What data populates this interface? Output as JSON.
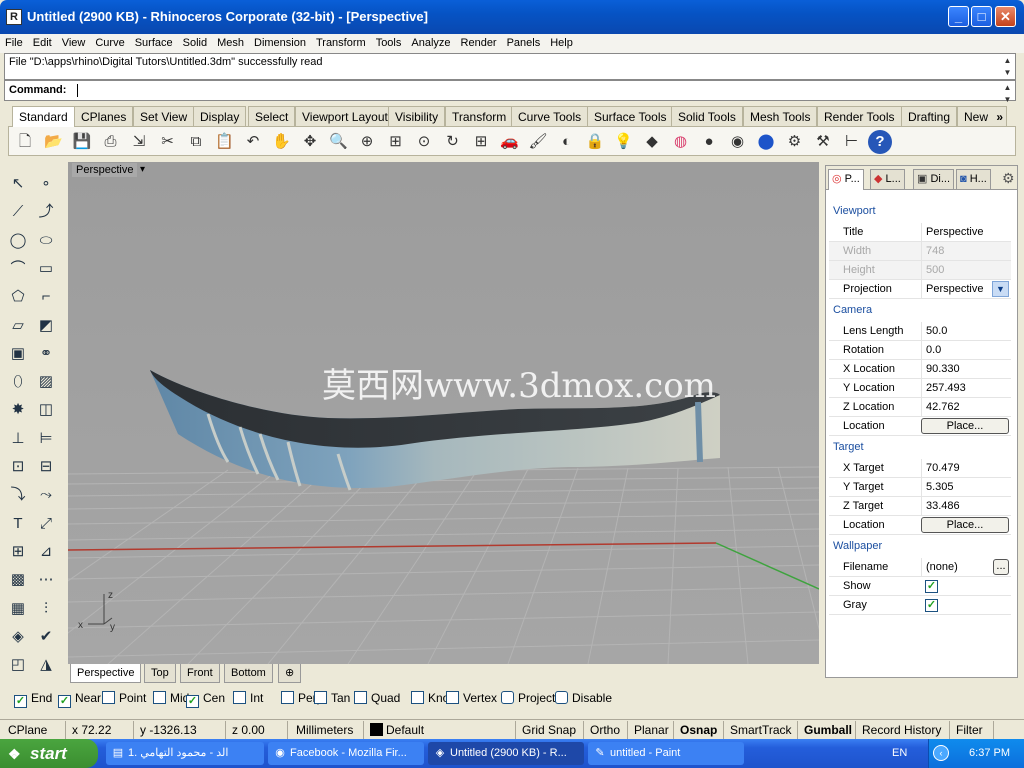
{
  "window": {
    "title": "Untitled (2900 KB) - Rhinoceros Corporate (32-bit) - [Perspective]",
    "minimize_glyph": "_",
    "maximize_glyph": "□",
    "close_glyph": "✕"
  },
  "menu": [
    "File",
    "Edit",
    "View",
    "Curve",
    "Surface",
    "Solid",
    "Mesh",
    "Dimension",
    "Transform",
    "Tools",
    "Analyze",
    "Render",
    "Panels",
    "Help"
  ],
  "command": {
    "history": "File \"D:\\apps\\rhino\\Digital Tutors\\Untitled.3dm\" successfully read",
    "label": "Command:"
  },
  "toolbar_tabs": [
    "Standard",
    "CPlanes",
    "Set View",
    "Display",
    "Select",
    "Viewport Layout",
    "Visibility",
    "Transform",
    "Curve Tools",
    "Surface Tools",
    "Solid Tools",
    "Mesh Tools",
    "Render Tools",
    "Drafting",
    "New"
  ],
  "toolbar_more": "»",
  "toolbar_icons": [
    "new-file-icon",
    "open-icon",
    "save-icon",
    "print-icon",
    "import-icon",
    "cut-icon",
    "copy-icon",
    "paste-icon",
    "undo-icon",
    "pan-icon",
    "rotate-view-icon",
    "zoom-icon",
    "zoom-window-icon",
    "zoom-extents-icon",
    "zoom-selected-icon",
    "rotate-icon",
    "four-viewports-icon",
    "car-icon",
    "paint-icon",
    "hide-icon",
    "lock-icon",
    "lightbulb-icon",
    "layer-icon",
    "color-wheel-icon",
    "sphere-shaded-icon",
    "sphere-render-icon",
    "sphere-blue-icon",
    "gear-icon",
    "options-icon",
    "dimension-icon",
    "help-icon"
  ],
  "left_tool_icons": [
    "select-arrow-icon",
    "point-icon",
    "polyline-icon",
    "curve-points-icon",
    "circle-icon",
    "ellipse-icon",
    "arc-icon",
    "rectangle-icon",
    "polygon-icon",
    "fillet-curve-icon",
    "surface-corner-icon",
    "extrude-surface-icon",
    "box-icon",
    "sphere-group-icon",
    "cylinder-icon",
    "surface-patch-icon",
    "explode-icon",
    "boolean-icon",
    "move-icon",
    "align-icon",
    "group-icon",
    "ungroup-icon",
    "curve-edit-icon",
    "curve-rebuild-icon",
    "text-icon",
    "scale-icon",
    "array-icon",
    "mirror-icon",
    "extrude-box-icon",
    "grid-dots-icon",
    "rectangle-grid-icon",
    "level-icon",
    "mesh-icon",
    "check-icon",
    "object-icon",
    "paint-bucket-icon"
  ],
  "viewport": {
    "title": "Perspective",
    "dropdown_glyph": "▾",
    "watermark": "莫西网www.3dmox.com",
    "axis_labels": {
      "x": "x",
      "y": "y",
      "z": "z"
    },
    "colors": {
      "background": "#9f9f9f",
      "grid": "#b4b4b4",
      "x_axis": "#b23a2e",
      "y_axis": "#3ea33e"
    }
  },
  "viewport_tabs": [
    "Perspective",
    "Top",
    "Front",
    "Bottom"
  ],
  "viewport_add_glyph": "⊕",
  "panel_tabs": [
    {
      "label": "P...",
      "icon": "color-ring-icon"
    },
    {
      "label": "L...",
      "icon": "layer-icon"
    },
    {
      "label": "Di...",
      "icon": "monitor-icon"
    },
    {
      "label": "H...",
      "icon": "help-icon"
    }
  ],
  "panel_settings_glyph": "⚙",
  "properties": {
    "viewport_header": "Viewport",
    "title_label": "Title",
    "title_value": "Perspective",
    "width_label": "Width",
    "width_value": "748",
    "height_label": "Height",
    "height_value": "500",
    "projection_label": "Projection",
    "projection_value": "Perspective",
    "camera_header": "Camera",
    "lens_label": "Lens Length",
    "lens_value": "50.0",
    "rotation_label": "Rotation",
    "rotation_value": "0.0",
    "xloc_label": "X Location",
    "xloc_value": "90.330",
    "yloc_label": "Y Location",
    "yloc_value": "257.493",
    "zloc_label": "Z Location",
    "zloc_value": "42.762",
    "loc_label": "Location",
    "place_label": "Place...",
    "target_header": "Target",
    "xt_label": "X Target",
    "xt_value": "70.479",
    "yt_label": "Y Target",
    "yt_value": "5.305",
    "zt_label": "Z Target",
    "zt_value": "33.486",
    "tloc_label": "Location",
    "tplace_label": "Place...",
    "wallpaper_header": "Wallpaper",
    "filename_label": "Filename",
    "filename_value": "(none)",
    "browse_label": "...",
    "show_label": "Show",
    "show_checked": true,
    "gray_label": "Gray",
    "gray_checked": true
  },
  "osnaps": [
    {
      "label": "End",
      "checked": true
    },
    {
      "label": "Near",
      "checked": true
    },
    {
      "label": "Point",
      "checked": false
    },
    {
      "label": "Mid",
      "checked": false
    },
    {
      "label": "Cen",
      "checked": true
    },
    {
      "label": "Int",
      "checked": false
    },
    {
      "label": "Perp",
      "checked": false
    },
    {
      "label": "Tan",
      "checked": false
    },
    {
      "label": "Quad",
      "checked": false
    },
    {
      "label": "Knot",
      "checked": false
    },
    {
      "label": "Vertex",
      "checked": false
    },
    {
      "label": "Project",
      "checked": false
    },
    {
      "label": "Disable",
      "checked": false
    }
  ],
  "status": {
    "cplane": "CPlane",
    "x": "x 72.22",
    "y": "y -1326.13",
    "z": "z 0.00",
    "units": "Millimeters",
    "layer": "Default",
    "grid_snap": "Grid Snap",
    "ortho": "Ortho",
    "planar": "Planar",
    "osnap": "Osnap",
    "smarttrack": "SmartTrack",
    "gumball": "Gumball",
    "record_history": "Record History",
    "filter": "Filter"
  },
  "taskbar": {
    "start": "start",
    "tasks": [
      {
        "label": "1. الد - محمود التهامي",
        "icon": "folder-icon",
        "active": false
      },
      {
        "label": "Facebook - Mozilla Fir...",
        "icon": "firefox-icon",
        "active": false
      },
      {
        "label": "Untitled (2900 KB) - R...",
        "icon": "rhino-icon",
        "active": true
      },
      {
        "label": "untitled - Paint",
        "icon": "paint-icon",
        "active": false
      }
    ],
    "language": "EN",
    "clock": "6:37 PM"
  }
}
